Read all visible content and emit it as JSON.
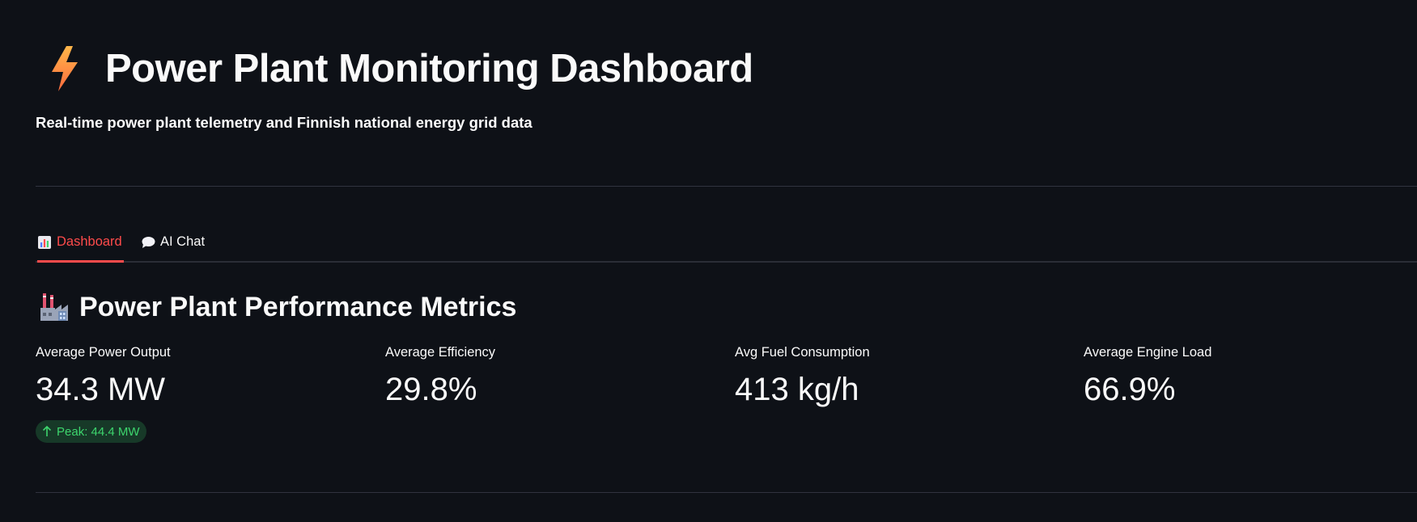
{
  "header": {
    "title": "Power Plant Monitoring Dashboard",
    "icon": "lightning-bolt-icon",
    "subtitle": "Real-time power plant telemetry and Finnish national energy grid data"
  },
  "tabs": [
    {
      "label": "Dashboard",
      "icon": "bar-chart-icon",
      "active": true
    },
    {
      "label": "AI Chat",
      "icon": "speech-bubble-icon",
      "active": false
    }
  ],
  "section": {
    "title": "Power Plant Performance Metrics",
    "icon": "factory-icon"
  },
  "metrics": [
    {
      "label": "Average Power Output",
      "value": "34.3 MW",
      "delta": "Peak: 44.4 MW",
      "delta_direction": "up"
    },
    {
      "label": "Average Efficiency",
      "value": "29.8%"
    },
    {
      "label": "Avg Fuel Consumption",
      "value": "413 kg/h"
    },
    {
      "label": "Average Engine Load",
      "value": "66.9%"
    }
  ],
  "colors": {
    "background": "#0e1117",
    "accent": "#ff4b4b",
    "delta_positive": "#3dd56d",
    "delta_positive_bg": "#173928"
  }
}
